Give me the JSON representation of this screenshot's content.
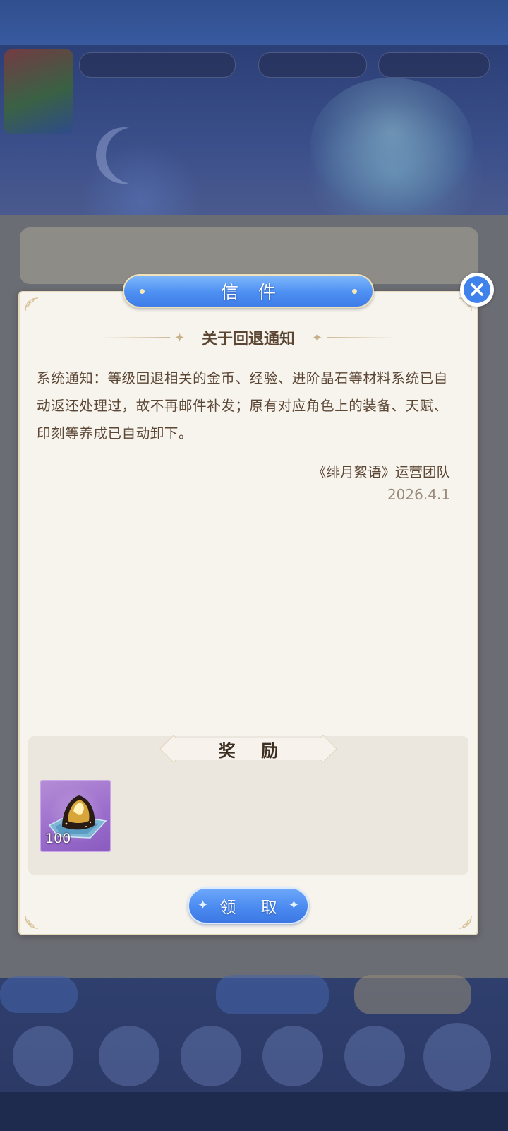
{
  "modal": {
    "title": "信 件",
    "close_icon": "close-icon",
    "subject": "关于回退通知",
    "body": "系统通知：等级回退相关的金币、经验、进阶晶石等材料系统已自动返还处理过，故不再邮件补发；原有对应角色上的装备、天赋、印刻等养成已自动卸下。",
    "signature": "《绯月絮语》运营团队",
    "date": "2026.4.1"
  },
  "rewards": {
    "header": "奖 励",
    "items": [
      {
        "icon": "golden-crystal-icon",
        "quantity": "100",
        "rarity_color": "#a77bd6"
      }
    ]
  },
  "claim_button": {
    "label": "领 取"
  },
  "colors": {
    "accent_blue": "#4b8af0",
    "panel_bg": "#f7f4ee",
    "text_brown": "#5c4634",
    "date_gray": "#9a8c7c"
  }
}
